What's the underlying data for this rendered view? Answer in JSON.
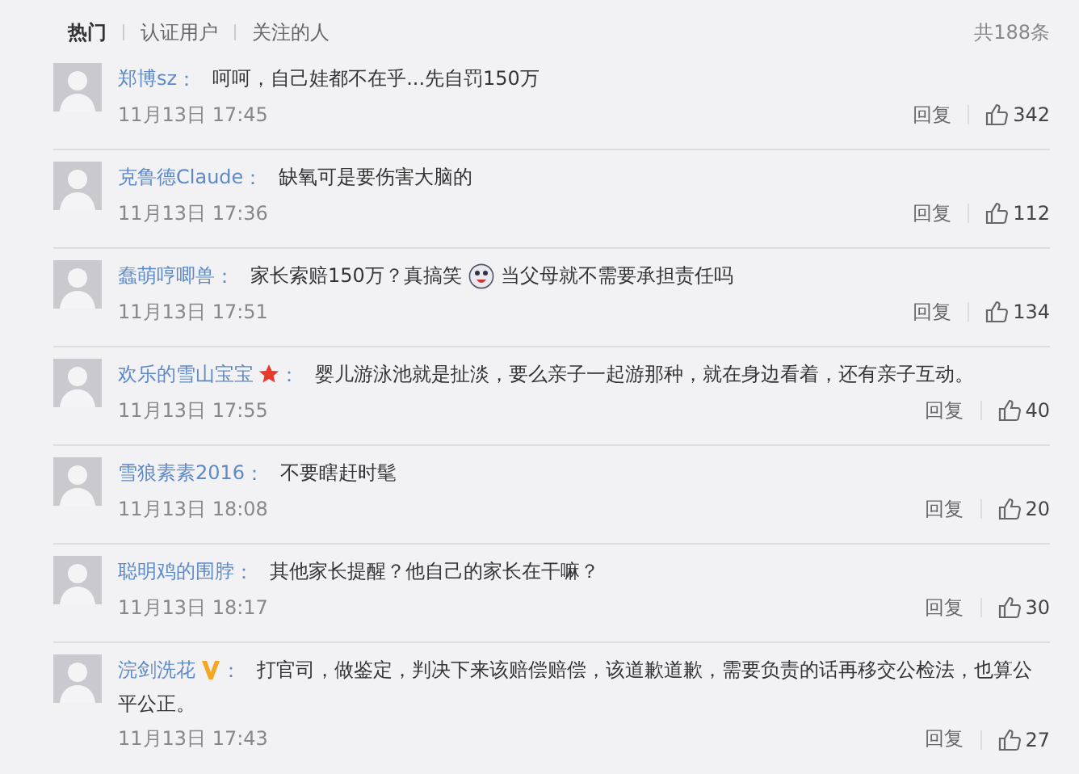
{
  "tabs": [
    {
      "label": "热门",
      "selected": true
    },
    {
      "label": "认证用户",
      "selected": false
    },
    {
      "label": "关注的人",
      "selected": false
    }
  ],
  "total": "共188条",
  "comments": [
    {
      "user": "郑博sz",
      "colon": "：",
      "content": [
        {
          "kind": "text",
          "text": "呵呵，自己娃都不在乎...先自罚150万"
        }
      ],
      "time": "11月13日 17:45",
      "reply": "回复",
      "likes": "342"
    },
    {
      "user": "克鲁德Claude",
      "colon": "：",
      "content": [
        {
          "kind": "text",
          "text": "缺氧可是要伤害大脑的"
        }
      ],
      "time": "11月13日 17:36",
      "reply": "回复",
      "likes": "112"
    },
    {
      "user": "蠢萌哼唧兽",
      "colon": "：",
      "content": [
        {
          "kind": "text",
          "text": "家长索赔150万？真搞笑"
        },
        {
          "kind": "emoji"
        },
        {
          "kind": "text",
          "text": "当父母就不需要承担责任吗"
        }
      ],
      "time": "11月13日 17:51",
      "reply": "回复",
      "likes": "134"
    },
    {
      "user": "欢乐的雪山宝宝",
      "badge": {
        "kind": "star"
      },
      "colon": "：",
      "content": [
        {
          "kind": "text",
          "text": "婴儿游泳池就是扯淡，要么亲子一起游那种，就在身边看着，还有亲子互动。"
        }
      ],
      "time": "11月13日 17:55",
      "reply": "回复",
      "likes": "40"
    },
    {
      "user": "雪狼素素2016",
      "colon": "：",
      "content": [
        {
          "kind": "text",
          "text": "不要瞎赶时髦"
        }
      ],
      "time": "11月13日 18:08",
      "reply": "回复",
      "likes": "20"
    },
    {
      "user": "聪明鸡的围脖",
      "colon": "：",
      "content": [
        {
          "kind": "text",
          "text": "其他家长提醒？他自己的家长在干嘛？"
        }
      ],
      "time": "11月13日 18:17",
      "reply": "回复",
      "likes": "30"
    },
    {
      "user": "浣剑洗花",
      "badge": {
        "kind": "vip"
      },
      "colon": "：",
      "content": [
        {
          "kind": "text",
          "text": "打官司，做鉴定，判决下来该赔偿赔偿，该道歉道歉，需要负责的话再移交公检法，也算公平公正。"
        }
      ],
      "time": "11月13日 17:43",
      "reply": "回复",
      "likes": "27"
    }
  ]
}
